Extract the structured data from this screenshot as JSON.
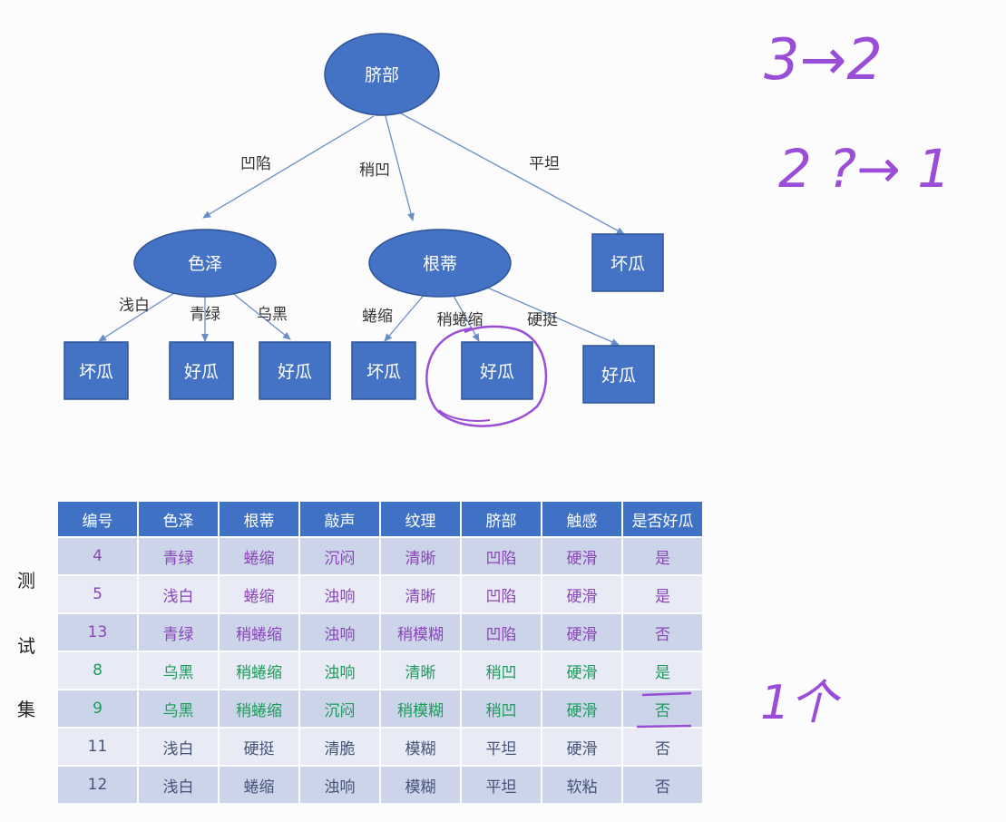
{
  "colors": {
    "node": "#4472c4",
    "node_stroke": "#2f5597",
    "edge": "#6a8cc7",
    "annotation": "#9a4dd6",
    "header": "#3f72c4"
  },
  "tree": {
    "root": "脐部",
    "root_edges": [
      "凹陷",
      "稍凹",
      "平坦"
    ],
    "left": {
      "label": "色泽",
      "edges": [
        "浅白",
        "青绿",
        "乌黑"
      ],
      "leaves": [
        "坏瓜",
        "好瓜",
        "好瓜"
      ]
    },
    "middle": {
      "label": "根蒂",
      "edges": [
        "蜷缩",
        "稍蜷缩",
        "硬挺"
      ],
      "leaves": [
        "坏瓜",
        "好瓜",
        "好瓜"
      ]
    },
    "right_leaf": "坏瓜"
  },
  "annotations": {
    "line1": "3→2",
    "line2": "2 ?→ 1",
    "count": "1个"
  },
  "side_label": [
    "测",
    "试",
    "集"
  ],
  "table": {
    "headers": [
      "编号",
      "色泽",
      "根蒂",
      "敲声",
      "纹理",
      "脐部",
      "触感",
      "是否好瓜"
    ],
    "rows": [
      [
        "4",
        "青绿",
        "蜷缩",
        "沉闷",
        "清晰",
        "凹陷",
        "硬滑",
        "是"
      ],
      [
        "5",
        "浅白",
        "蜷缩",
        "浊响",
        "清晰",
        "凹陷",
        "硬滑",
        "是"
      ],
      [
        "13",
        "青绿",
        "稍蜷缩",
        "浊响",
        "稍模糊",
        "凹陷",
        "硬滑",
        "否"
      ],
      [
        "8",
        "乌黑",
        "稍蜷缩",
        "浊响",
        "清晰",
        "稍凹",
        "硬滑",
        "是"
      ],
      [
        "9",
        "乌黑",
        "稍蜷缩",
        "沉闷",
        "稍模糊",
        "稍凹",
        "硬滑",
        "否"
      ],
      [
        "11",
        "浅白",
        "硬挺",
        "清脆",
        "模糊",
        "平坦",
        "硬滑",
        "否"
      ],
      [
        "12",
        "浅白",
        "蜷缩",
        "浊响",
        "模糊",
        "平坦",
        "软粘",
        "否"
      ]
    ]
  }
}
